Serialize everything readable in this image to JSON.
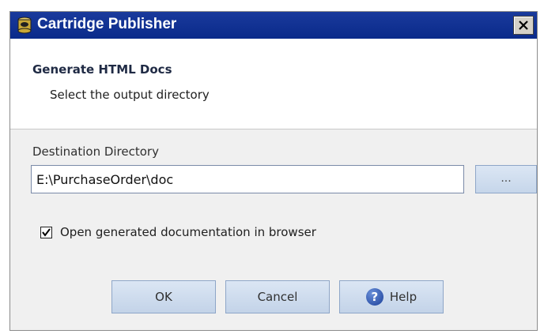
{
  "window": {
    "title": "Cartridge Publisher",
    "icon": "database-cartridge-icon",
    "close_icon": "close-icon"
  },
  "header": {
    "title": "Generate HTML Docs",
    "subtitle": "Select the output directory"
  },
  "form": {
    "destination_label": "Destination Directory",
    "destination_value": "E:\\PurchaseOrder\\doc",
    "browse_label": "...",
    "open_in_browser_label": "Open generated documentation in browser",
    "open_in_browser_checked": true
  },
  "buttons": {
    "ok_label": "OK",
    "cancel_label": "Cancel",
    "help_label": "Help",
    "help_icon": "help-icon"
  },
  "colors": {
    "titlebar": "#0a2a8a",
    "button_face": "#c6d6ea",
    "window_bg": "#f0f0f0"
  }
}
